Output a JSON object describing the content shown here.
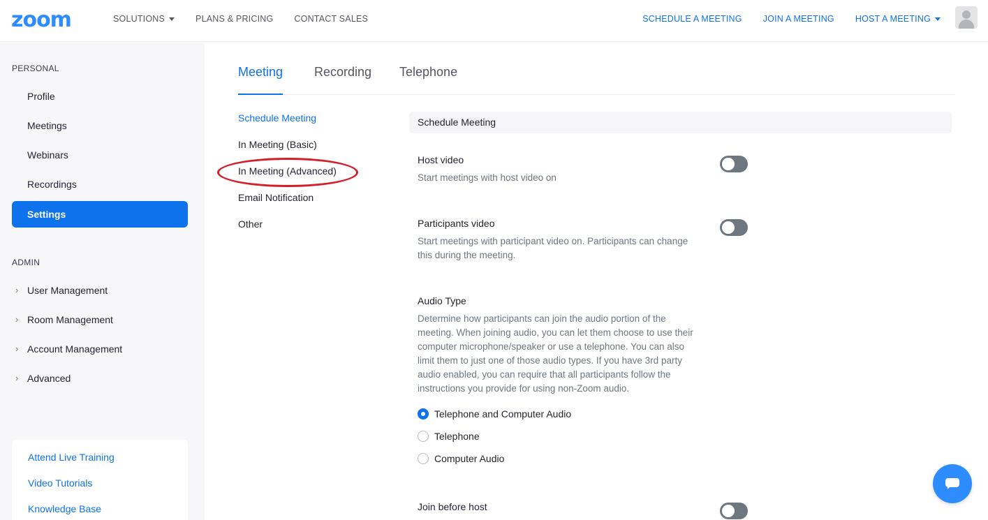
{
  "header": {
    "logo": "zoom",
    "nav_left": [
      {
        "label": "SOLUTIONS",
        "has_caret": true
      },
      {
        "label": "PLANS & PRICING"
      },
      {
        "label": "CONTACT SALES"
      }
    ],
    "nav_right": [
      {
        "label": "SCHEDULE A MEETING"
      },
      {
        "label": "JOIN A MEETING"
      },
      {
        "label": "HOST A MEETING",
        "has_caret": true
      }
    ]
  },
  "sidebar": {
    "personal_label": "PERSONAL",
    "personal_items": [
      {
        "label": "Profile"
      },
      {
        "label": "Meetings"
      },
      {
        "label": "Webinars"
      },
      {
        "label": "Recordings"
      },
      {
        "label": "Settings",
        "active": true
      }
    ],
    "admin_label": "ADMIN",
    "admin_items": [
      {
        "label": "User Management"
      },
      {
        "label": "Room Management"
      },
      {
        "label": "Account Management"
      },
      {
        "label": "Advanced"
      }
    ],
    "help_links": [
      {
        "label": "Attend Live Training"
      },
      {
        "label": "Video Tutorials"
      },
      {
        "label": "Knowledge Base"
      }
    ]
  },
  "tabs": [
    {
      "label": "Meeting",
      "active": true
    },
    {
      "label": "Recording"
    },
    {
      "label": "Telephone"
    }
  ],
  "sub_nav": [
    {
      "label": "Schedule Meeting",
      "active": true
    },
    {
      "label": "In Meeting (Basic)"
    },
    {
      "label": "In Meeting (Advanced)",
      "highlighted": true
    },
    {
      "label": "Email Notification"
    },
    {
      "label": "Other"
    }
  ],
  "content": {
    "section_title": "Schedule Meeting",
    "host_video": {
      "title": "Host video",
      "desc": "Start meetings with host video on",
      "enabled": false
    },
    "participants_video": {
      "title": "Participants video",
      "desc_line1": "Start meetings with participant video on. Participants can change",
      "desc_line2": "this during the meeting.",
      "enabled": false
    },
    "audio_type": {
      "title": "Audio Type",
      "desc_lines": [
        "Determine how participants can join the audio portion of the",
        "meeting. When joining audio, you can let them choose to use their",
        "computer microphone/speaker or use a telephone. You can also",
        "limit them to just one of those audio types. If you have 3rd party",
        "audio enabled, you can require that all participants follow the",
        "instructions you provide for using non-Zoom audio."
      ],
      "options": [
        {
          "label": "Telephone and Computer Audio",
          "selected": true
        },
        {
          "label": "Telephone",
          "selected": false
        },
        {
          "label": "Computer Audio",
          "selected": false
        }
      ]
    },
    "join_before_host": {
      "title": "Join before host",
      "enabled": false
    }
  },
  "colors": {
    "accent": "#0e72ed",
    "logo": "#2d8cff",
    "toggle_off": "#6e7680",
    "highlight_ellipse": "#d41f2a"
  }
}
